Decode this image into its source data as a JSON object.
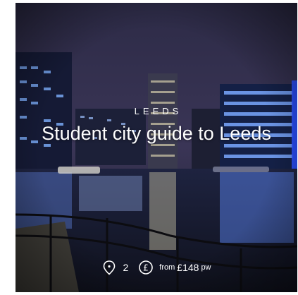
{
  "card": {
    "city": "LEEDS",
    "title": "Student city guide to Leeds",
    "properties_count": "2",
    "price_prefix": "from",
    "price_amount": "£148",
    "price_suffix": "pw",
    "location_icon": "map-pin-icon",
    "price_icon": "pound-circle-icon"
  },
  "colors": {
    "text": "#ffffff",
    "sky": "#2b2a48",
    "water": "#1a1c2e",
    "building_light": "#6fa8ff"
  }
}
